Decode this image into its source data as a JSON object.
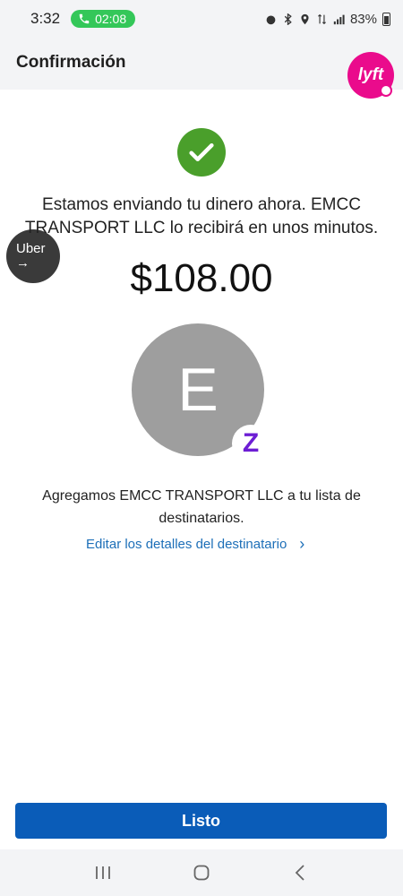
{
  "status_bar": {
    "time": "3:32",
    "call_timer": "02:08",
    "battery": "83%",
    "icons": [
      "alarm-icon",
      "bluetooth-icon",
      "location-icon",
      "data-icon",
      "signal-icon",
      "battery-icon"
    ]
  },
  "app_bar": {
    "title": "Confirmación"
  },
  "overlays": {
    "lyft_label": "lyft",
    "uber_label": "Uber",
    "uber_arrow": "→"
  },
  "confirmation": {
    "message": "Estamos enviando tu dinero ahora. EMCC TRANSPORT LLC lo recibirá en unos minutos.",
    "amount": "$108.00",
    "avatar_initial": "E",
    "zelle_glyph": "Z",
    "added_text": "Agregamos EMCC TRANSPORT LLC a tu lista de destinatarios.",
    "edit_link": "Editar los detalles del destinatario",
    "edit_chevron": "›"
  },
  "actions": {
    "done_label": "Listo"
  },
  "colors": {
    "success": "#4a9f2b",
    "primary": "#0a5cb8",
    "link": "#1d6fb8",
    "zelle": "#6d1ed4",
    "lyft": "#ea0b8c",
    "call_pill": "#34c759"
  }
}
